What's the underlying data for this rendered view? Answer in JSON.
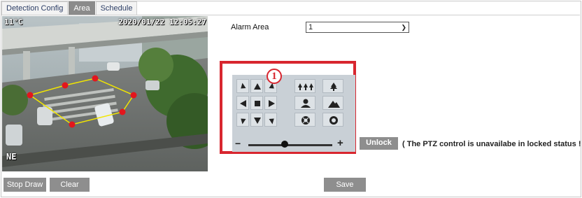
{
  "tabs": [
    {
      "label": "Detection Config",
      "active": false
    },
    {
      "label": "Area",
      "active": true
    },
    {
      "label": "Schedule",
      "active": false
    }
  ],
  "video": {
    "temperature": "11°C",
    "timestamp": "2020/01/22 12:05:27",
    "direction": "NE"
  },
  "alarm": {
    "label": "Alarm Area",
    "selected": "1"
  },
  "ptz": {
    "badge": "1",
    "zoom_minus": "−",
    "zoom_plus": "+",
    "unlock_label": "Unlock",
    "note": "( The PTZ control is unavailabe in locked status ! )"
  },
  "buttons": {
    "stop_draw": "Stop Draw",
    "clear": "Clear",
    "save": "Save"
  },
  "colors": {
    "accent_red": "#d8262f",
    "button_gray": "#8e8e8e",
    "zone_line": "#f2e600",
    "zone_point": "#e3161c"
  },
  "icons": [
    "arrow-up-left-icon",
    "arrow-up-icon",
    "arrow-up-right-icon",
    "arrow-left-icon",
    "stop-icon",
    "arrow-right-icon",
    "arrow-down-left-icon",
    "arrow-down-icon",
    "arrow-down-right-icon",
    "focus-far-icon",
    "focus-near-icon",
    "person-icon",
    "landscape-icon",
    "iris-open-icon",
    "iris-close-icon"
  ]
}
